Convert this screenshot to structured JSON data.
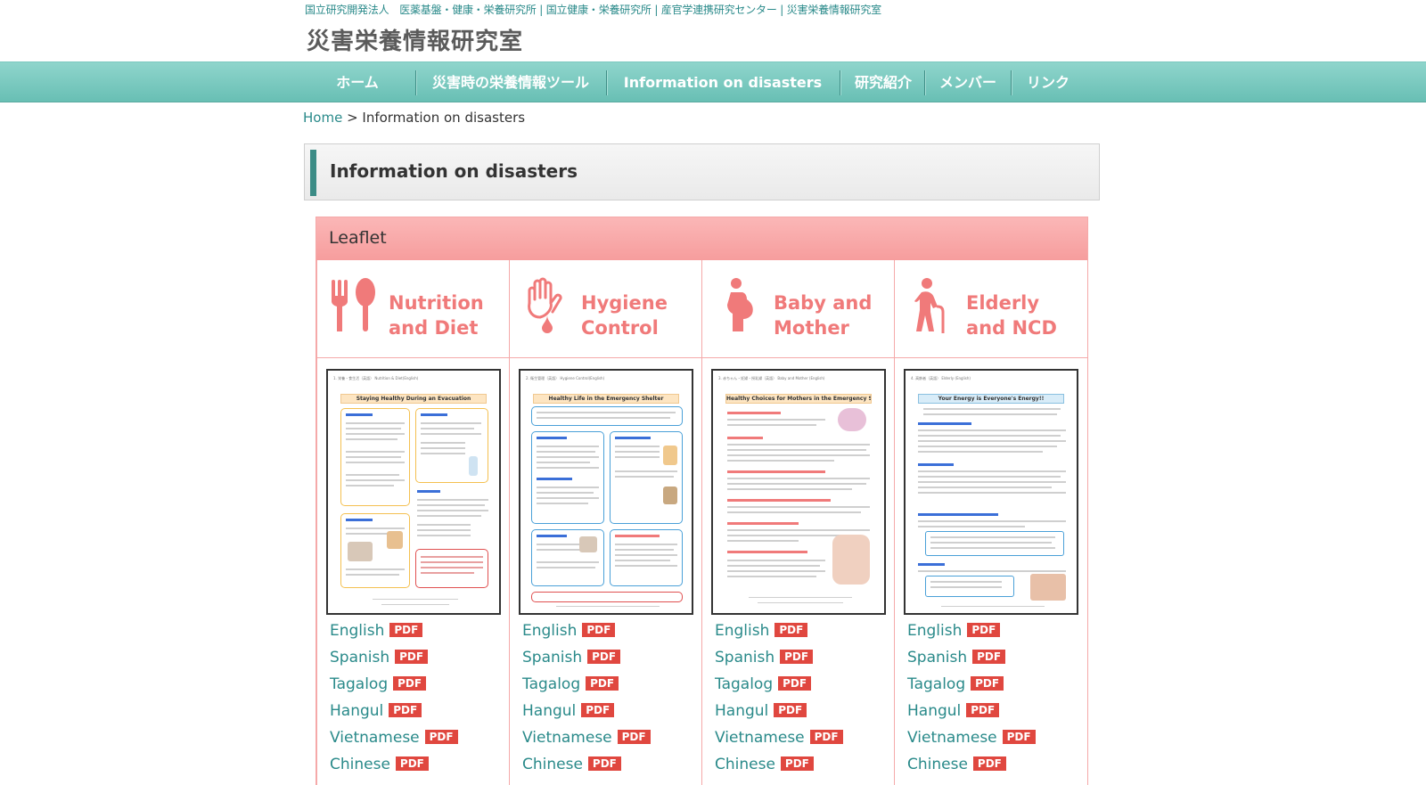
{
  "header": {
    "top_links": [
      "国立研究開発法人　医薬基盤・健康・栄養研究所",
      "国立健康・栄養研究所",
      "産官学連携研究センター",
      "災害栄養情報研究室"
    ],
    "site_title": "災害栄養情報研究室"
  },
  "nav": {
    "items": [
      {
        "label": "ホーム"
      },
      {
        "label": "災害時の栄養情報ツール"
      },
      {
        "label": "Information on disasters"
      },
      {
        "label": "研究紹介"
      },
      {
        "label": "メンバー"
      },
      {
        "label": "リンク"
      }
    ]
  },
  "breadcrumb": {
    "home": "Home",
    "separator": " > ",
    "current": "Information on disasters"
  },
  "page_heading": "Information on disasters",
  "leaflet": {
    "title": "Leaflet",
    "pdf_label": "PDF",
    "columns": [
      {
        "title_line1": "Nutrition",
        "title_line2": "and Diet",
        "icon": "fork-spoon-icon",
        "thumb_header": "1. 栄養・食生活（英語） Nutrition & Diet(English)",
        "thumb_title": "Staying Healthy During an Evacuation",
        "languages": [
          "English",
          "Spanish",
          "Tagalog",
          "Hangul",
          "Vietnamese",
          "Chinese"
        ]
      },
      {
        "title_line1": "Hygiene",
        "title_line2": "Control",
        "icon": "hand-washing-icon",
        "thumb_header": "2. 衛生管理（英語） Hygiene Control(English)",
        "thumb_title": "Healthy Life in the Emergency Shelter",
        "languages": [
          "English",
          "Spanish",
          "Tagalog",
          "Hangul",
          "Vietnamese",
          "Chinese"
        ]
      },
      {
        "title_line1": "Baby and",
        "title_line2": "Mother",
        "icon": "pregnant-mother-icon",
        "thumb_header": "3. 赤ちゃん・妊婦・授乳婦（英語） Baby and Mother (English)",
        "thumb_title": "Healthy Choices for Mothers in the Emergency Shelter",
        "languages": [
          "English",
          "Spanish",
          "Tagalog",
          "Hangul",
          "Vietnamese",
          "Chinese"
        ]
      },
      {
        "title_line1": "Elderly",
        "title_line2": "and NCD",
        "icon": "elderly-cane-icon",
        "thumb_header": "4. 高齢者（英語） Elderly (English)",
        "thumb_title": "Your Energy is Everyone's Energy!!",
        "languages": [
          "English",
          "Spanish",
          "Tagalog",
          "Hangul",
          "Vietnamese",
          "Chinese"
        ]
      }
    ]
  },
  "colors": {
    "accent_teal": "#2a8a8a",
    "nav_teal": "#68bfb4",
    "leaflet_pink": "#f69d9d",
    "category_pink": "#f07a7a",
    "pdf_red": "#e0473f"
  }
}
